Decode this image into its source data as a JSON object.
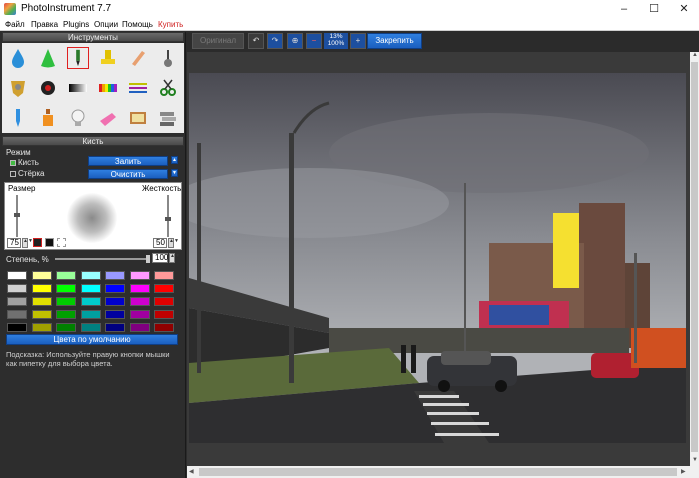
{
  "window": {
    "title": "PhotoInstrument 7.7",
    "minimize": "–",
    "maximize": "☐",
    "close": "✕"
  },
  "menu": {
    "items": [
      "Файл",
      "Правка",
      "Plugins",
      "Опции",
      "Помощь",
      "Купить"
    ]
  },
  "tools_panel": {
    "header": "Инструменты",
    "tools": [
      "drop-icon",
      "cone-icon",
      "brush-icon",
      "stamp-icon",
      "eraser-icon",
      "stick-icon",
      "shield-icon",
      "eye-icon",
      "gradient-icon",
      "rainbow-icon",
      "lines-icon",
      "scissors-icon",
      "tube-icon",
      "bottle-icon",
      "bulb-icon",
      "cleaner-icon",
      "paint-icon",
      "layers-icon"
    ]
  },
  "brush_panel": {
    "header": "Кисть",
    "mode_label": "Режим",
    "mode_brush": "Кисть",
    "mode_eraser": "Стёрка",
    "fill_button": "Залить",
    "clear_button": "Очистить",
    "size_label": "Размер",
    "hardness_label": "Жесткость",
    "size_value": "75",
    "hardness_value": "50",
    "step_label": "Степень, %",
    "step_value": "100",
    "default_colors_button": "Цвета по умолчанию",
    "hint": "Подсказка: Используйте правую кнопки мышки как пипетку для выбора цвета."
  },
  "palette": {
    "rows": [
      [
        "#ffffff",
        "#ffff99",
        "#99ff99",
        "#99ffff",
        "#9999ff",
        "#ff99ff",
        "#ff9999"
      ],
      [
        "#d0d0d0",
        "#ffff00",
        "#00ff00",
        "#00ffff",
        "#0000ff",
        "#ff00ff",
        "#ff0000"
      ],
      [
        "#a0a0a0",
        "#e0e000",
        "#00cc00",
        "#00cccc",
        "#0000cc",
        "#cc00cc",
        "#e00000"
      ],
      [
        "#707070",
        "#c0c000",
        "#00a000",
        "#00a0a0",
        "#0000a0",
        "#a000a0",
        "#c00000"
      ],
      [
        "#000000",
        "#a0a000",
        "#008000",
        "#008080",
        "#000080",
        "#800080",
        "#900000"
      ]
    ]
  },
  "toolbar": {
    "original_button": "Оригинал",
    "zoom_top": "13%",
    "zoom_bottom": "100%",
    "commit_button": "Закрепить"
  }
}
